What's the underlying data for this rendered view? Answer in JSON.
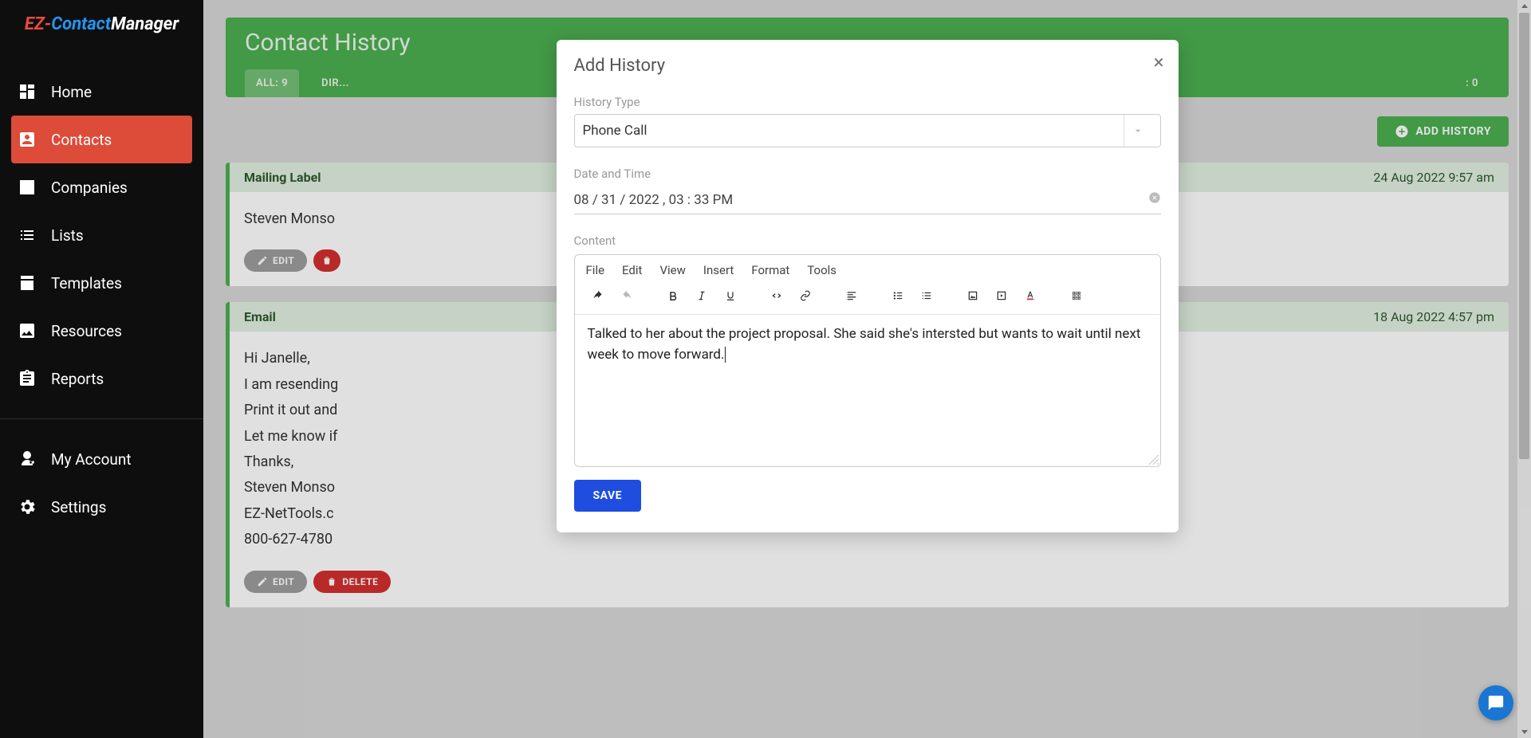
{
  "brand": "EZ-ContactManager",
  "sidebar": {
    "items": [
      {
        "label": "Home"
      },
      {
        "label": "Contacts",
        "active": true
      },
      {
        "label": "Companies"
      },
      {
        "label": "Lists"
      },
      {
        "label": "Templates"
      },
      {
        "label": "Resources"
      },
      {
        "label": "Reports"
      },
      {
        "label": "My Account"
      },
      {
        "label": "Settings"
      }
    ]
  },
  "header": {
    "title": "Contact History",
    "tabs": [
      {
        "label": "ALL: 9",
        "active": true
      },
      {
        "label": "DIR..."
      },
      {
        "label": ": 0"
      }
    ],
    "add_button": "ADD HISTORY"
  },
  "cards": [
    {
      "title": "Mailing Label",
      "date": "24 Aug 2022 9:57 am",
      "body_lines": [
        "Steven Monso"
      ]
    },
    {
      "title": "Email",
      "date": "18 Aug 2022 4:57 pm",
      "body_lines": [
        "Hi Janelle,",
        "",
        "I am resending",
        "",
        "Print it out and",
        "",
        "Let me know if",
        "",
        "Thanks,",
        "Steven Monso",
        "EZ-NetTools.c",
        "800-627-4780"
      ]
    }
  ],
  "buttons": {
    "edit": "EDIT",
    "delete": "DELETE"
  },
  "modal": {
    "title": "Add History",
    "labels": {
      "type": "History Type",
      "datetime": "Date and Time",
      "content": "Content"
    },
    "type_value": "Phone Call",
    "datetime": "08 / 31 / 2022 ,  03 : 33   PM",
    "menus": [
      "File",
      "Edit",
      "View",
      "Insert",
      "Format",
      "Tools"
    ],
    "content": "Talked to her about the project proposal.  She said she's intersted but wants to wait until next week to move forward.",
    "save": "SAVE"
  }
}
